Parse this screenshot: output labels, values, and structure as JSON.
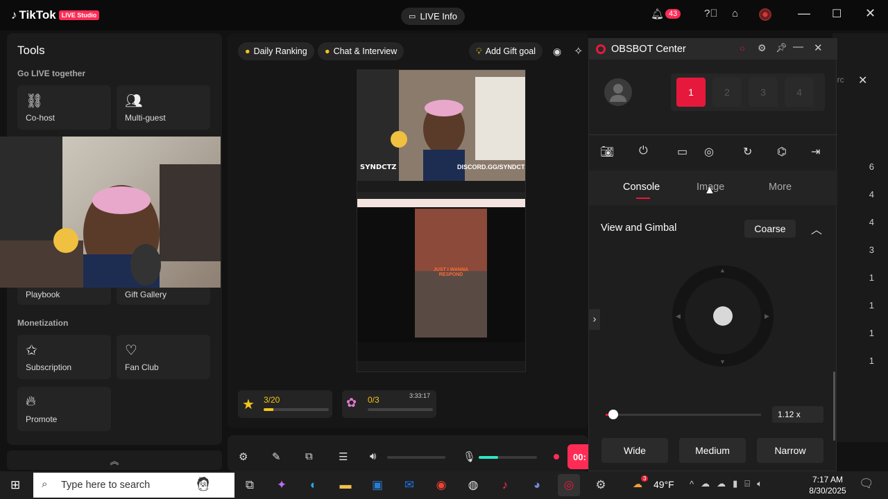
{
  "app": {
    "brand": "TikTok",
    "badge": "LIVE Studio",
    "live_info": "LIVE Info",
    "notifications": "43"
  },
  "tools": {
    "title": "Tools",
    "section_live": "Go LIVE together",
    "cohost": "Co-host",
    "multiguest": "Multi-guest",
    "playbook": "Playbook",
    "gift_gallery": "Gift Gallery",
    "section_monetization": "Monetization",
    "subscription": "Subscription",
    "fan_club": "Fan Club",
    "promote": "Promote"
  },
  "center": {
    "daily_ranking": "Daily Ranking",
    "chat_interview": "Chat & Interview",
    "add_gift_goal": "Add Gift goal",
    "goal1": "3/20",
    "goal1_progress": 0.15,
    "goal2": "0/3",
    "goal2_progress": 0,
    "goal2_time": "3:33:17",
    "timer": "00:"
  },
  "preview": {
    "handle": "SYNDCTZ",
    "discord": "DISCORD.GG/SYNDCTZ",
    "caption": "JUST I WANNA RESPOND"
  },
  "right_list": [
    "6",
    "4",
    "4",
    "3",
    "1",
    "1",
    "1",
    "1"
  ],
  "obsbot": {
    "title": "OBSBOT Center",
    "slots": [
      "1",
      "2",
      "3",
      "4"
    ],
    "tabs": [
      "Console",
      "Image",
      "More"
    ],
    "active_tab": "Console",
    "section": "View and Gimbal",
    "coarse": "Coarse",
    "zoom": "1.12 x",
    "zoom_level": 0.05,
    "wide": "Wide",
    "medium": "Medium",
    "narrow": "Narrow",
    "bg_text": "erc"
  },
  "taskbar": {
    "search_placeholder": "Type here to search",
    "weather": "49°F",
    "time": "7:17 AM",
    "date": "8/30/2025",
    "weather_badge": "3"
  },
  "colors": {
    "accent": "#fe2c55",
    "obs_red": "#e6193c",
    "gold": "#f5c518"
  }
}
